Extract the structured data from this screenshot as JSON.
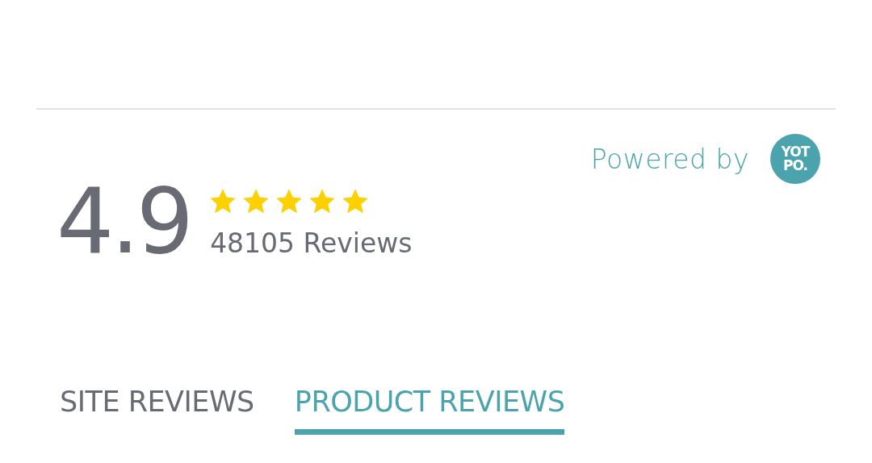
{
  "powered_by": {
    "label": "Powered by",
    "logo_lines": [
      "YOT",
      "PO."
    ]
  },
  "summary": {
    "rating": "4.9",
    "stars": 5,
    "reviews_count": "48105 Reviews"
  },
  "tabs": [
    {
      "label": "SITE REVIEWS",
      "selected": false
    },
    {
      "label": "PRODUCT REVIEWS",
      "selected": true
    }
  ]
}
